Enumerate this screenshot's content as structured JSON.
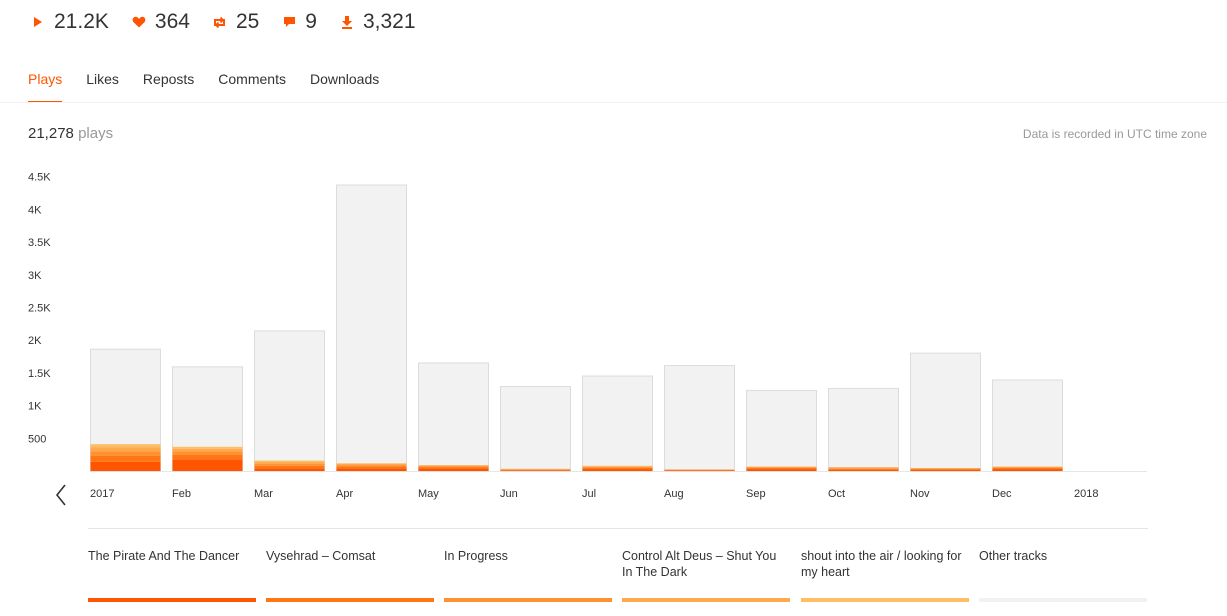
{
  "stats": {
    "plays": "21.2K",
    "likes": "364",
    "reposts": "25",
    "comments": "9",
    "downloads": "3,321"
  },
  "icons": {
    "plays": "play-icon",
    "likes": "heart-icon",
    "reposts": "repost-icon",
    "comments": "comment-icon",
    "downloads": "download-icon",
    "prev": "chevron-left-icon"
  },
  "tabs": [
    "Plays",
    "Likes",
    "Reposts",
    "Comments",
    "Downloads"
  ],
  "active_tab": "Plays",
  "summary": {
    "count": "21,278",
    "unit": "plays"
  },
  "timezone_note": "Data is recorded in UTC time zone",
  "colors": {
    "accent": "#ff5500",
    "bar_background": "#f2f2f2",
    "tracks": [
      "#ff5500",
      "#ff7613",
      "#ff9130",
      "#ffa84c",
      "#ffbd66"
    ]
  },
  "chart_data": {
    "type": "bar",
    "stacked": true,
    "categories": [
      "2017",
      "Feb",
      "Mar",
      "Apr",
      "May",
      "Jun",
      "Jul",
      "Aug",
      "Sep",
      "Oct",
      "Nov",
      "Dec",
      "2018"
    ],
    "totals": [
      1870,
      1600,
      2150,
      4380,
      1660,
      1300,
      1460,
      1620,
      1240,
      1270,
      1810,
      1400,
      0
    ],
    "series": [
      {
        "name": "The Pirate And The Dancer",
        "values": [
          140,
          180,
          40,
          40,
          40,
          10,
          30,
          10,
          30,
          20,
          20,
          30,
          0
        ]
      },
      {
        "name": "Vysehrad - Comsat",
        "values": [
          90,
          70,
          40,
          30,
          20,
          10,
          20,
          5,
          15,
          15,
          10,
          15,
          0
        ]
      },
      {
        "name": "In Progress",
        "values": [
          70,
          50,
          30,
          20,
          15,
          5,
          15,
          5,
          10,
          10,
          10,
          10,
          0
        ]
      },
      {
        "name": "Control Alt Deus - Shut You In The Dark",
        "values": [
          60,
          40,
          30,
          20,
          10,
          5,
          10,
          5,
          10,
          10,
          5,
          10,
          0
        ]
      },
      {
        "name": "shout into the air / looking for my heart",
        "values": [
          50,
          30,
          20,
          10,
          5,
          5,
          5,
          0,
          5,
          5,
          0,
          5,
          0
        ]
      }
    ],
    "yticks": [
      "500",
      "1K",
      "1.5K",
      "2K",
      "2.5K",
      "3K",
      "3.5K",
      "4K",
      "4.5K"
    ],
    "ylim": [
      0,
      4500
    ],
    "grid": false,
    "legend_position": "bottom"
  },
  "legend": [
    "The Pirate And The Dancer",
    "Vysehrad – Comsat",
    "In Progress",
    "Control Alt Deus – Shut You In The Dark",
    "shout into the air / looking for my heart",
    "Other tracks"
  ]
}
